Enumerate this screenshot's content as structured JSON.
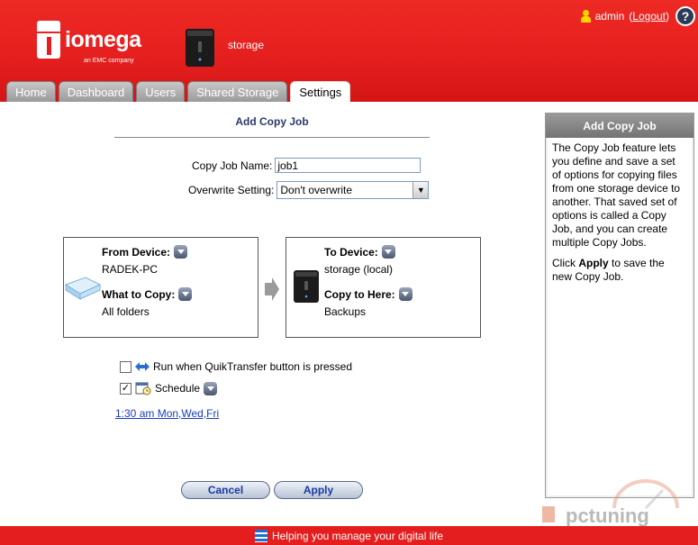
{
  "header": {
    "logo_text": "iomega",
    "logo_sub": "an EMC company",
    "device_name": "storage",
    "user_label": "admin",
    "logout_label": "Logout",
    "help_label": "?"
  },
  "tabs": [
    {
      "label": "Home"
    },
    {
      "label": "Dashboard"
    },
    {
      "label": "Users"
    },
    {
      "label": "Shared Storage"
    },
    {
      "label": "Settings"
    }
  ],
  "main": {
    "title": "Add Copy Job",
    "job_name_label": "Copy Job Name:",
    "job_name_value": "job1",
    "overwrite_label": "Overwrite Setting:",
    "overwrite_value": "Don't overwrite"
  },
  "from_box": {
    "device_label": "From Device:",
    "device_value": "RADEK-PC",
    "what_label": "What to Copy:",
    "what_value": "All folders"
  },
  "to_box": {
    "device_label": "To Device:",
    "device_value": "storage (local)",
    "where_label": "Copy to Here:",
    "where_value": "Backups"
  },
  "options": {
    "quiktransfer_label": "Run when QuikTransfer button is pressed",
    "quiktransfer_checked": false,
    "schedule_label": "Schedule",
    "schedule_checked": true,
    "schedule_link": "1:30 am Mon,Wed,Fri"
  },
  "buttons": {
    "cancel": "Cancel",
    "apply": "Apply"
  },
  "side_panel": {
    "title": "Add Copy Job",
    "para1": "The Copy Job feature lets you define and save a set of options for copying files from one storage device to another. That saved set of options is called a Copy Job, and you can create multiple Copy Jobs.",
    "para2_prefix": "Click ",
    "para2_bold": "Apply",
    "para2_suffix": " to save the new Copy Job."
  },
  "watermark": "pctuning",
  "footer": {
    "text": "Helping you manage your digital life"
  },
  "colors": {
    "brand_red": "#e41e1e",
    "link_blue": "#1a3cc4",
    "title_navy": "#2a3a6a"
  }
}
